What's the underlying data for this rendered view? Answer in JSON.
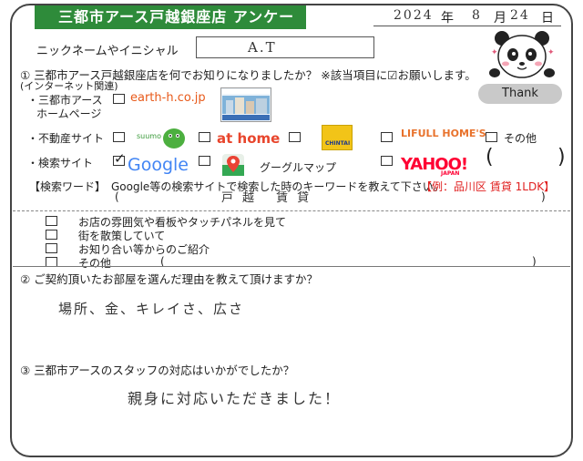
{
  "title": "三都市アース戸越銀座店 アンケート",
  "date": {
    "year": "2024",
    "year_label": "年",
    "month": "8",
    "month_label": "月",
    "day": "24",
    "day_label": "日"
  },
  "nickname": {
    "label": "ニックネームやイニシャル",
    "value": "A.T"
  },
  "q1": {
    "question": "① 三都市アース戸越銀座店を何でお知りになりましたか？ ※該当項目に☑お願いします。",
    "internet_note": "(インターネット関連)",
    "homepage_label_1": "・三都市アース",
    "homepage_label_2": "ホームページ",
    "homepage_url": "earth-h.co.jp",
    "fudosan_label": "・不動産サイト",
    "suumo": "suumo",
    "athome": "at home",
    "chintai": "CHINTAI",
    "lifull": "LIFULL HOME'S",
    "other": "その他",
    "search_label": "・検索サイト",
    "google": "Google",
    "googlemap": "グーグルマップ",
    "yahoo": "YAHOO!",
    "yahoo_sub": "JAPAN",
    "keyword_label": "【検索ワード】",
    "keyword_prompt": "Google等の検索サイトで検索した時のキーワードを教えて下さい。",
    "keyword_example": "【例：品川区 賃貸 1LDK】",
    "keyword_answer": "戸越 賃貸",
    "offline_1": "お店の雰囲気や看板やタッチパネルを見て",
    "offline_2": "街を散策していて",
    "offline_3": "お知り合い等からのご紹介",
    "offline_4": "その他"
  },
  "q2": {
    "question": "② ご契約頂いたお部屋を選んだ理由を教えて頂けますか？",
    "answer": "場所、金、キレイさ、広さ"
  },
  "q3": {
    "question": "③ 三都市アースのスタッフの対応はいかがでしたか？",
    "answer": "親身に対応いただきました！"
  },
  "mascot": {
    "thank": "Thank"
  }
}
